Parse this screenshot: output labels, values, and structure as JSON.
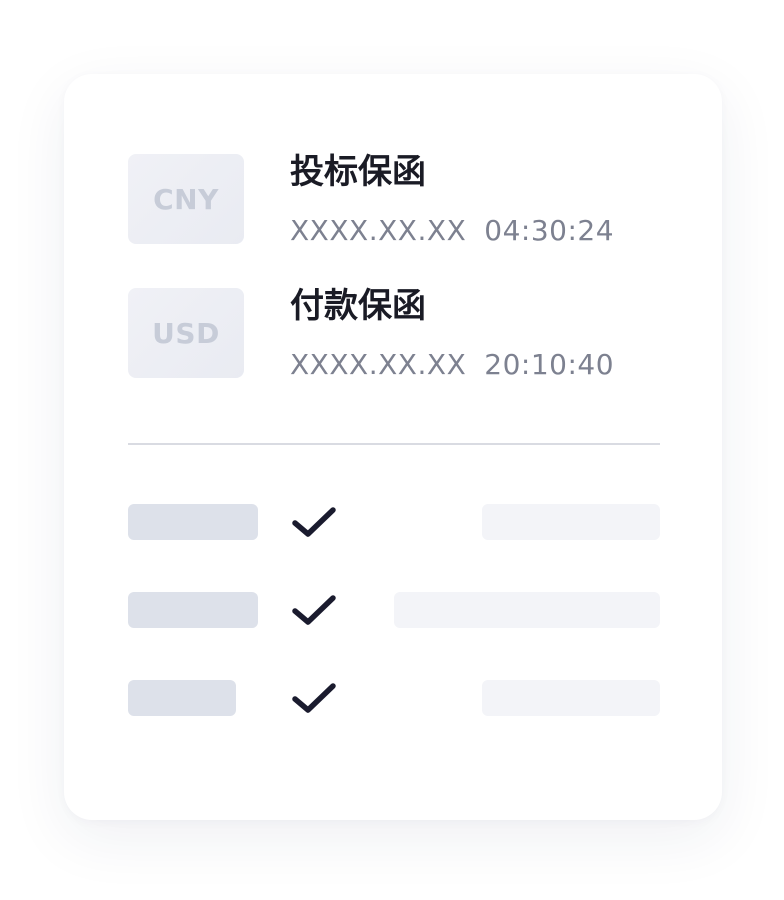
{
  "entries": [
    {
      "currency": "CNY",
      "title": "投标保函",
      "date": "XXXX.XX.XX",
      "time": "04:30:24"
    },
    {
      "currency": "USD",
      "title": "付款保函",
      "date": "XXXX.XX.XX",
      "time": "20:10:40"
    }
  ],
  "checklist": [
    {
      "status": "checked",
      "icon": "checkmark-icon"
    },
    {
      "status": "checked",
      "icon": "checkmark-icon"
    },
    {
      "status": "checked",
      "icon": "checkmark-icon"
    }
  ],
  "colors": {
    "title": "#1a1b25",
    "meta": "#7d8190",
    "badge_text": "#c7ccd8",
    "placeholder_dark": "#dde1ea",
    "placeholder_light": "#f3f4f8",
    "check": "#1a1b2e"
  }
}
